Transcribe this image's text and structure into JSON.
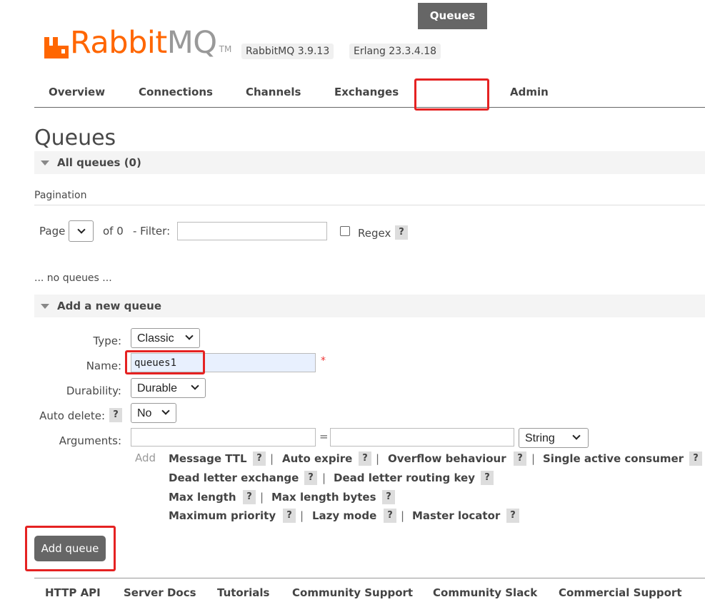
{
  "brand": {
    "name_orange": "Rabbit",
    "name_gray": "MQ",
    "tm": "TM",
    "color": "#ff6600"
  },
  "versions": {
    "rabbitmq": "RabbitMQ 3.9.13",
    "erlang": "Erlang 23.3.4.18"
  },
  "nav": {
    "items": [
      "Overview",
      "Connections",
      "Channels",
      "Exchanges",
      "Queues",
      "Admin"
    ],
    "active": "Queues"
  },
  "page_title": "Queues",
  "all_queues": {
    "label": "All queues (0)"
  },
  "pagination": {
    "heading": "Pagination",
    "page_label": "Page",
    "of_label": "of 0",
    "filter_label": "- Filter:",
    "filter_value": "",
    "regex_label": "Regex",
    "help": "?"
  },
  "empty_message": "... no queues ...",
  "add_queue": {
    "section_label": "Add a new queue",
    "type_label": "Type:",
    "type_value": "Classic",
    "name_label": "Name:",
    "name_value": "queues1",
    "required_mark": "*",
    "durability_label": "Durability:",
    "durability_value": "Durable",
    "auto_delete_label": "Auto delete:",
    "auto_delete_value": "No",
    "arguments_label": "Arguments:",
    "arg_key": "",
    "equals": "=",
    "arg_value": "",
    "arg_type": "String",
    "add_label": "Add",
    "arg_links": {
      "message_ttl": "Message TTL",
      "auto_expire": "Auto expire",
      "overflow": "Overflow behaviour",
      "single_active": "Single active consumer",
      "dlx": "Dead letter exchange",
      "dlrk": "Dead letter routing key",
      "max_length": "Max length",
      "max_length_bytes": "Max length bytes",
      "max_priority": "Maximum priority",
      "lazy_mode": "Lazy mode",
      "master_locator": "Master locator"
    },
    "button": "Add queue"
  },
  "footer": [
    "HTTP API",
    "Server Docs",
    "Tutorials",
    "Community Support",
    "Community Slack",
    "Commercial Support"
  ],
  "highlight_color": "#e52222"
}
